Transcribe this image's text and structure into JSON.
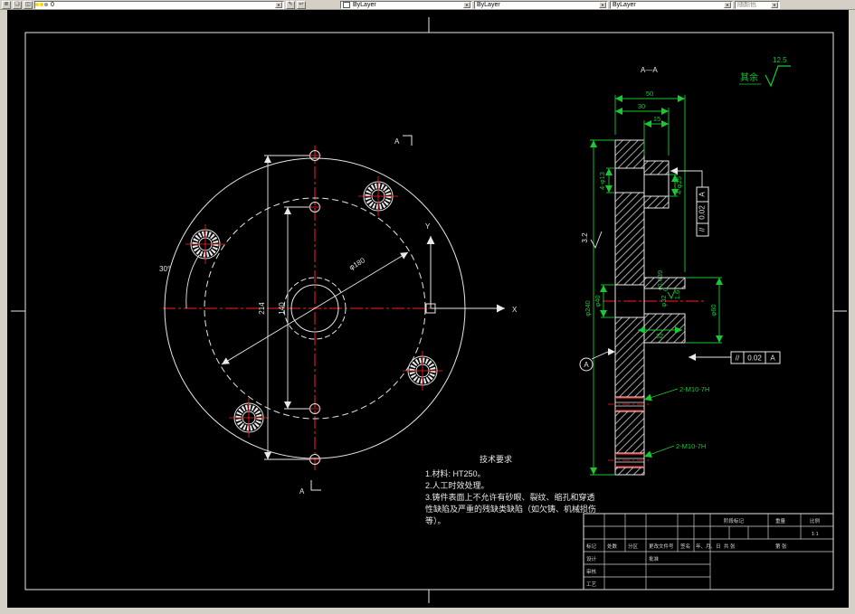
{
  "colors": {
    "background": "#000000",
    "line_white": "#e8e8e8",
    "centerline_red": "#ff2020",
    "dimension_green": "#19c832",
    "toolbar_bg": "#d4d0c8"
  },
  "toolbar": {
    "layer_value": "0",
    "color_value": "ByLayer",
    "linetype_value": "ByLayer",
    "lineweight_value": "ByLayer",
    "plotstyle_value": "随颜色",
    "dropdown_arrow": "▼"
  },
  "drawing": {
    "section_title": "A—A",
    "general_roughness": {
      "prefix": "其余",
      "value": "12.5"
    },
    "front": {
      "dim_214": "214",
      "dim_140": "140",
      "dim_d180": "φ180",
      "dim_30deg": "30°",
      "section_label_top": "A",
      "section_label_bottom": "A",
      "axis_x": "X",
      "axis_y": "Y"
    },
    "section": {
      "dim_50": "50",
      "dim_30": "30",
      "dim_15": "15",
      "dim_d240": "φ240",
      "dim_d60": "φ60",
      "dim_d40": "φ40",
      "dim_32": "32",
      "dim_d32": "φ32",
      "dim_d32_tol_sup": "+0.039",
      "dim_d32_tol_sub": "0",
      "dim_4xd13": "4-φ13",
      "dim_4xd25": "4-φ25",
      "rough_32": "3.2",
      "rough_16": "1.6",
      "thread_label_1": "2-M10-7H",
      "thread_label_2": "2-M10-7H",
      "fcf_parallel": {
        "symbol": "//",
        "value": "0.02",
        "datum": "A"
      },
      "fcf_vertical": {
        "symbol": "//",
        "value": "0.02",
        "datum": "A"
      },
      "datum_label": "A"
    },
    "tech_req": {
      "title": "技术要求",
      "line1": "1.材料: HT250。",
      "line2": "2.人工时效处理。",
      "line3": "3.铸件表面上不允许有砂眼、裂纹、缩孔和穿透",
      "line4": "性缺陷及严重的残缺类缺陷（如欠铸、机械损伤",
      "line5": "等）。"
    },
    "titleblock": {
      "h1": "标记",
      "h2": "处数",
      "h3": "分区",
      "h4": "更改文件号",
      "h5": "签名",
      "h6": "年、月、日",
      "r1": "设计",
      "r2": "审核",
      "r3": "工艺",
      "r4": "批准",
      "stage": "阶段标记",
      "weight": "重量",
      "scale": "比例",
      "scale_value": "1:1",
      "sheets_total": "共 张",
      "sheet_no": "第 张"
    }
  }
}
